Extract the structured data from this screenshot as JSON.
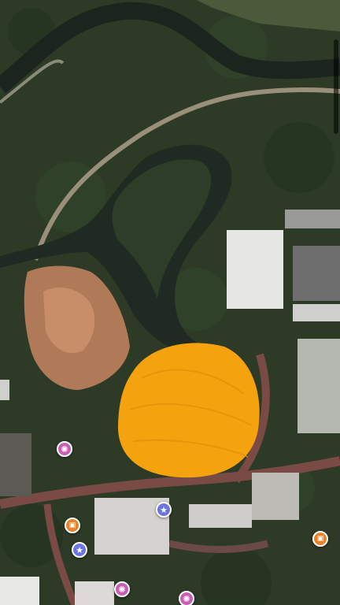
{
  "map": {
    "view": "satellite",
    "colors": {
      "foliage": "#2c3a26",
      "water": "#1f2a22",
      "river_edge": "#34442f",
      "path": "#9a8f7a",
      "rock": "#b07a58",
      "roof": "#e6e6e4",
      "redaction": "#f5a20f"
    },
    "markers": [
      {
        "type": "ride",
        "icon": "ferris-wheel-icon",
        "glyph": "✺"
      },
      {
        "type": "attraction",
        "icon": "star-icon",
        "glyph": "★"
      },
      {
        "type": "bus",
        "icon": "bus-icon",
        "glyph": "▣"
      },
      {
        "type": "attraction",
        "icon": "star-icon",
        "glyph": "★"
      },
      {
        "type": "bus",
        "icon": "bus-icon",
        "glyph": "▣"
      },
      {
        "type": "ride",
        "icon": "ferris-wheel-icon",
        "glyph": "✺"
      },
      {
        "type": "ride",
        "icon": "ferris-wheel-icon",
        "glyph": "✺"
      }
    ]
  }
}
